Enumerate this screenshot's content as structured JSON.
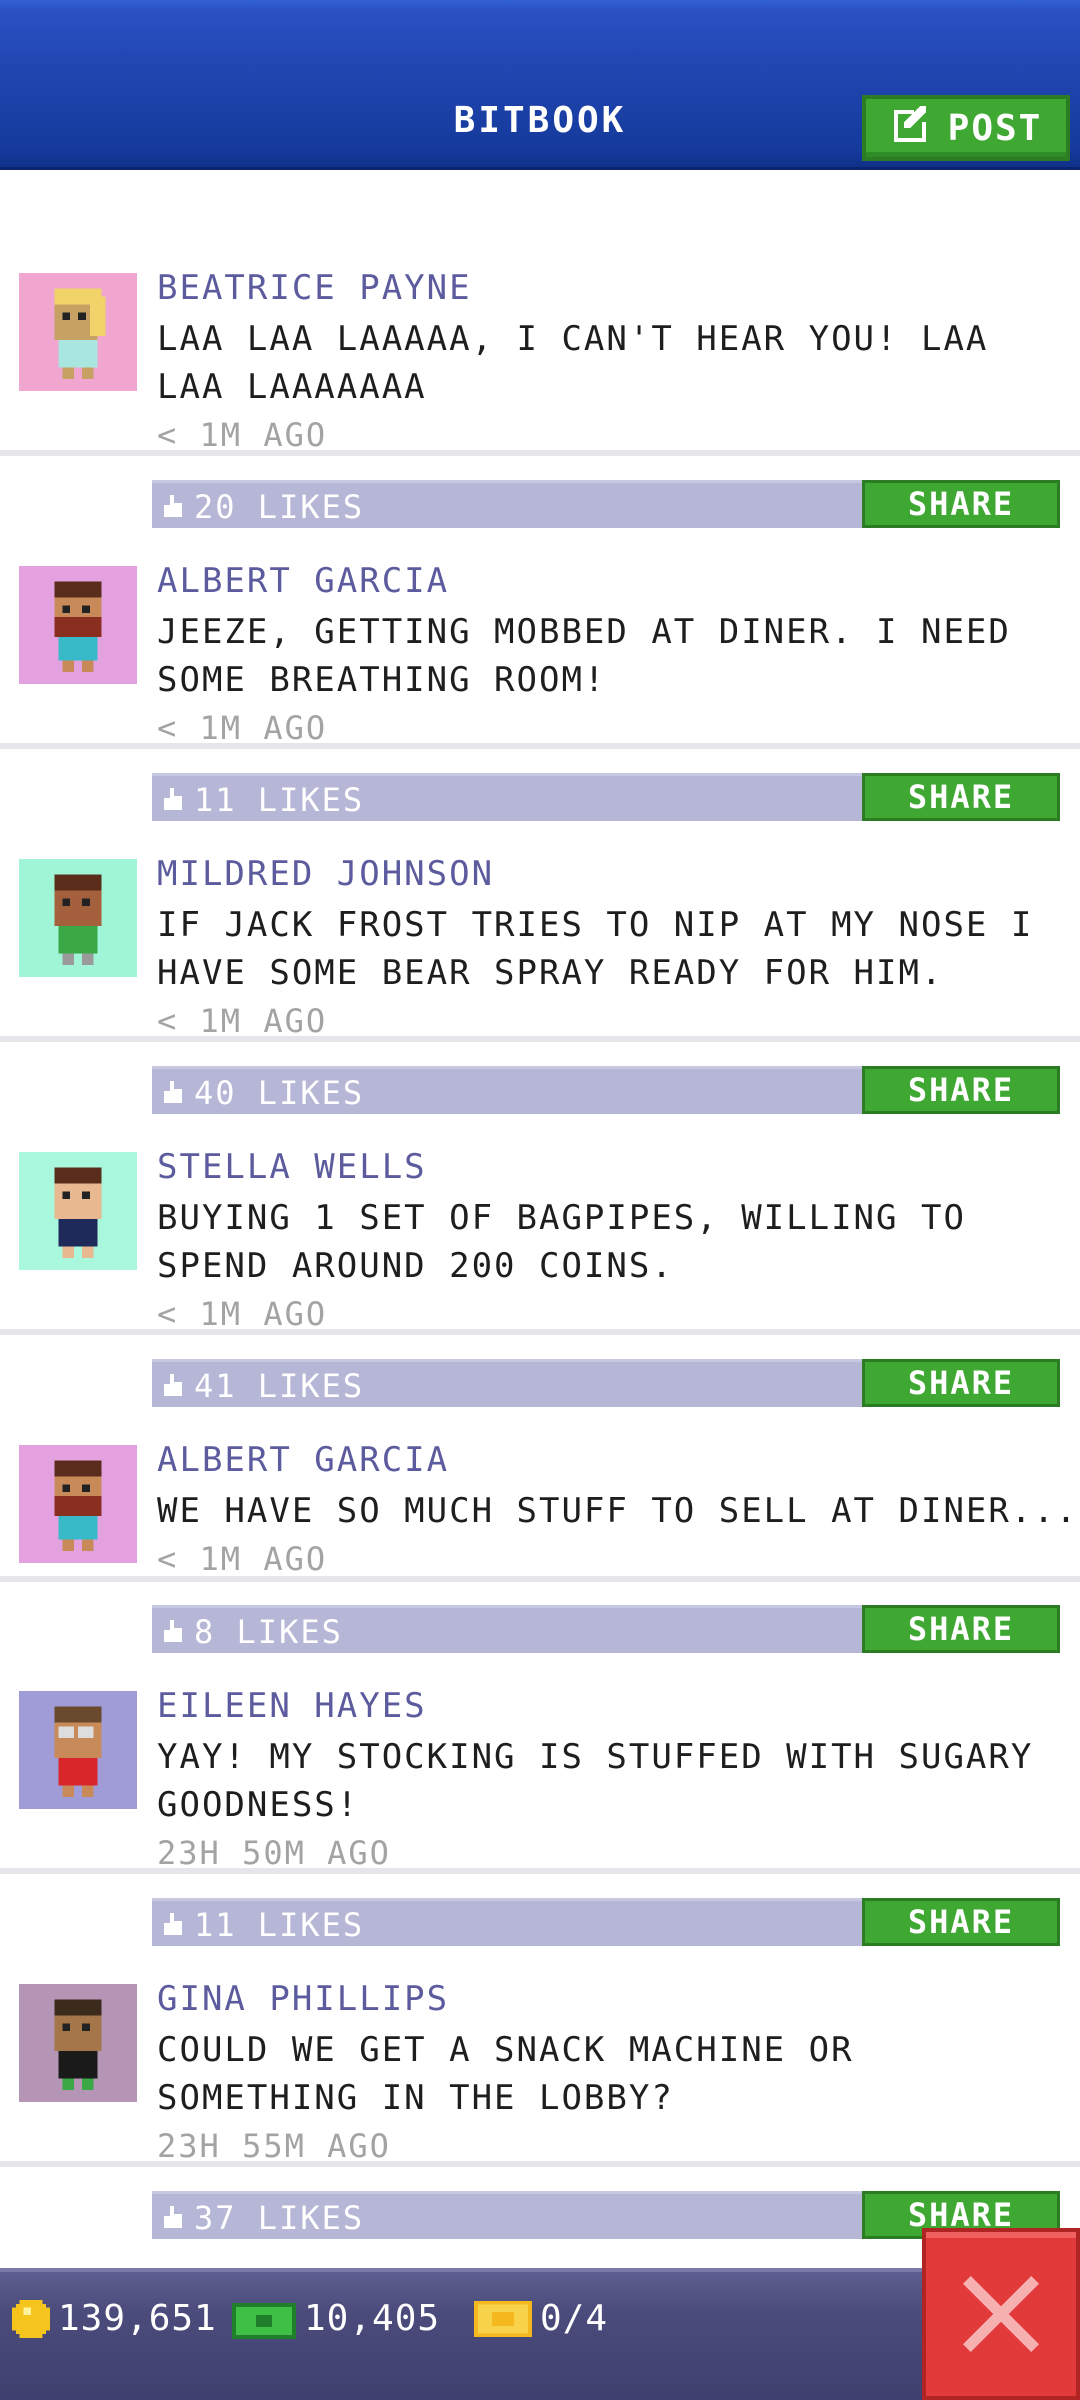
{
  "header": {
    "title": "BITBOOK",
    "post_label": "POST"
  },
  "posts": [
    {
      "name": "BEATRICE PAYNE",
      "message": "LAA LAA LAAAAA, I CAN'T HEAR YOU! LAA LAA LAAAAAAA",
      "time": "< 1M AGO",
      "likes": "20 LIKES",
      "share": "SHARE",
      "avatar_bg": "#f0a6cf"
    },
    {
      "name": "ALBERT GARCIA",
      "message": "JEEZE, GETTING MOBBED AT DINER. I NEED SOME BREATHING ROOM!",
      "time": "< 1M AGO",
      "likes": "11 LIKES",
      "share": "SHARE",
      "avatar_bg": "#e4a1e0"
    },
    {
      "name": "MILDRED JOHNSON",
      "message": "IF JACK FROST TRIES TO NIP AT MY NOSE I HAVE SOME BEAR SPRAY READY FOR HIM.",
      "time": "< 1M AGO",
      "likes": "40 LIKES",
      "share": "SHARE",
      "avatar_bg": "#9ff5d5"
    },
    {
      "name": "STELLA WELLS",
      "message": "BUYING 1 SET OF BAGPIPES, WILLING TO SPEND AROUND 200 COINS.",
      "time": "< 1M AGO",
      "likes": "41 LIKES",
      "share": "SHARE",
      "avatar_bg": "#a9f7dd"
    },
    {
      "name": "ALBERT GARCIA",
      "message": "WE HAVE SO MUCH STUFF TO SELL AT DINER...",
      "time": "< 1M AGO",
      "likes": "8 LIKES",
      "share": "SHARE",
      "avatar_bg": "#e4a1e0"
    },
    {
      "name": "EILEEN HAYES",
      "message": "YAY! MY STOCKING IS STUFFED WITH SUGARY GOODNESS!",
      "time": "23H 50M AGO",
      "likes": "11 LIKES",
      "share": "SHARE",
      "avatar_bg": "#a09cd8"
    },
    {
      "name": "GINA PHILLIPS",
      "message": "COULD WE GET A SNACK MACHINE OR SOMETHING IN THE LOBBY?",
      "time": "23H 55M AGO",
      "likes": "37 LIKES",
      "share": "SHARE",
      "avatar_bg": "#b595b5"
    }
  ],
  "status_bar": {
    "coins": "139,651",
    "bux": "10,405",
    "tickets": "0/4"
  },
  "colors": {
    "header_blue": "#2247b3",
    "accent_green": "#3fa833",
    "name_purple": "#5c5b9e",
    "like_bar": "#b6b6d6",
    "close_red": "#e23a3a"
  },
  "icons": [
    "edit-icon",
    "like-icon",
    "coin-icon",
    "bux-icon",
    "ticket-icon",
    "close-icon"
  ]
}
